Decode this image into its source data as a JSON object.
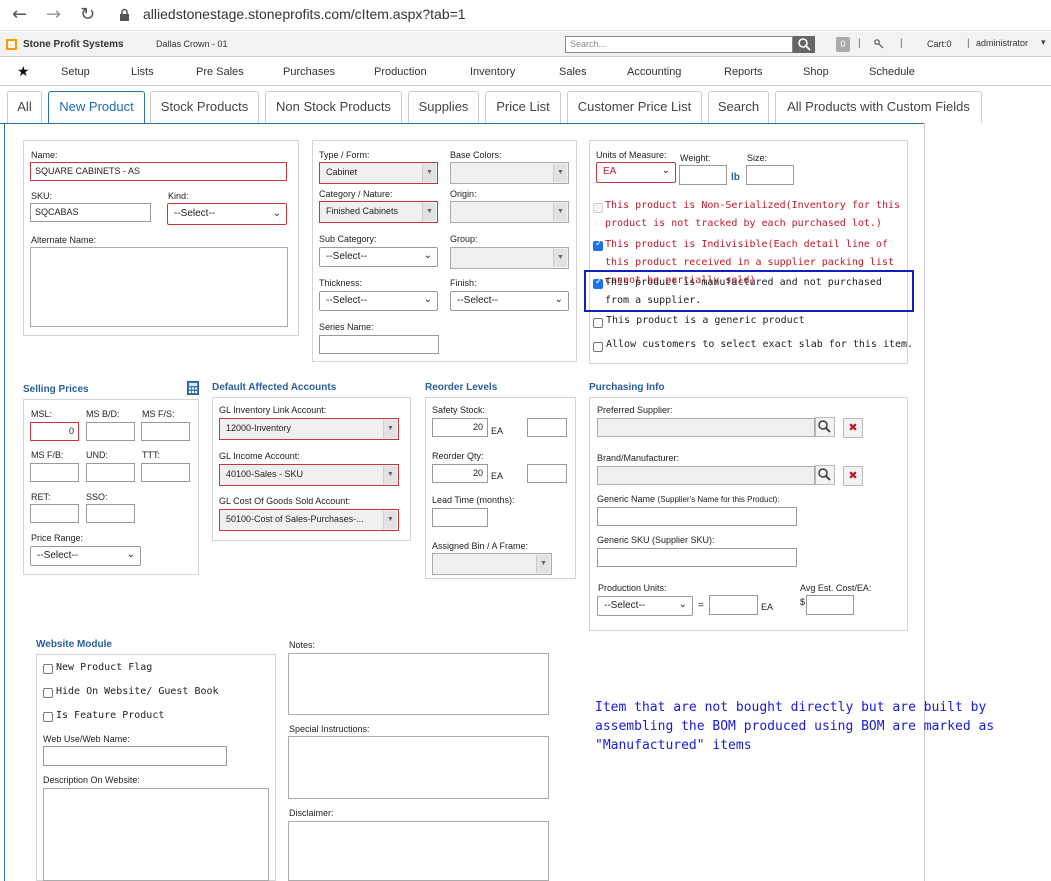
{
  "browser": {
    "back_icon": "arrow-left",
    "forward_icon": "arrow-right",
    "reload_icon": "reload",
    "lock_icon": "lock",
    "url": "alliedstonestage.stoneprofits.com/cItem.aspx?tab=1"
  },
  "header": {
    "brand": "Stone Profit Systems",
    "location": "Dallas Crown - 01",
    "search_placeholder": "Search...",
    "badge": "0",
    "cart": "Cart:0",
    "user": "administrator"
  },
  "nav": {
    "items": [
      "Setup",
      "Lists",
      "Pre Sales",
      "Purchases",
      "Production",
      "Inventory",
      "Sales",
      "Accounting",
      "Reports",
      "Shop",
      "Schedule"
    ]
  },
  "tabs": {
    "items": [
      "All",
      "New Product",
      "Stock Products",
      "Non Stock Products",
      "Supplies",
      "Price List",
      "Customer Price List",
      "Search",
      "All Products with Custom Fields"
    ],
    "active": "New Product"
  },
  "general": {
    "name_label": "Name:",
    "name_value": "SQUARE CABINETS - AS",
    "sku_label": "SKU:",
    "sku_value": "SQCABAS",
    "kind_label": "Kind:",
    "kind_value": "--Select--",
    "alt_name_label": "Alternate Name:"
  },
  "classification": {
    "type_label": "Type / Form:",
    "type_value": "Cabinet",
    "base_colors_label": "Base Colors:",
    "category_label": "Category / Nature:",
    "category_value": "Finished Cabinets",
    "origin_label": "Origin:",
    "subcategory_label": "Sub Category:",
    "subcategory_value": "--Select--",
    "group_label": "Group:",
    "thickness_label": "Thickness:",
    "thickness_value": "--Select--",
    "finish_label": "Finish:",
    "finish_value": "--Select--",
    "series_label": "Series Name:"
  },
  "units": {
    "uom_label": "Units of Measure:",
    "uom_value": "EA",
    "weight_label": "Weight:",
    "weight_unit": "lb",
    "size_label": "Size:",
    "opt_nonserialized": "This product is Non-Serialized(Inventory for this product is not tracked by each purchased lot.)",
    "opt_indivisible": "This product is Indivisible(Each detail line of this product received in a supplier packing list cannot be partially sold)",
    "opt_manufactured": "This product is manufactured and not purchased from a supplier.",
    "opt_generic": "This product is a generic product",
    "opt_exact_slab": "Allow customers to select exact slab for this item."
  },
  "selling": {
    "title": "Selling Prices",
    "msl_label": "MSL:",
    "msl_value": "0",
    "msbd_label": "MS B/D:",
    "msfs_label": "MS F/S:",
    "msfb_label": "MS F/B:",
    "und_label": "UND:",
    "ttt_label": "TTT:",
    "ret_label": "RET:",
    "sso_label": "SSO:",
    "price_range_label": "Price Range:",
    "price_range_value": "--Select--"
  },
  "accounts": {
    "title": "Default Affected Accounts",
    "inv_label": "GL Inventory Link Account:",
    "inv_value": "12000-Inventory",
    "income_label": "GL Income Account:",
    "income_value": "40100-Sales - SKU",
    "cogs_label": "GL Cost Of Goods Sold Account:",
    "cogs_value": "50100-Cost of Sales-Purchases-..."
  },
  "reorder": {
    "title": "Reorder Levels",
    "safety_label": "Safety Stock:",
    "safety_value": "20",
    "safety_unit": "EA",
    "reorder_label": "Reorder Qty:",
    "reorder_value": "20",
    "reorder_unit": "EA",
    "lead_label": "Lead Time (months):",
    "bin_label": "Assigned Bin / A Frame:"
  },
  "purchasing": {
    "title": "Purchasing Info",
    "pref_supplier_label": "Preferred Supplier:",
    "brand_label": "Brand/Manufacturer:",
    "generic_name_label": "Generic Name",
    "generic_name_hint": "(Supplier's Name for this Product):",
    "generic_sku_label": "Generic SKU (Supplier SKU):",
    "prod_units_label": "Production Units:",
    "prod_units_value": "--Select--",
    "equals": "=",
    "prod_units_unit": "EA",
    "avg_cost_label": "Avg Est. Cost/EA:",
    "currency": "$"
  },
  "website": {
    "title": "Website Module",
    "new_flag": "New Product Flag",
    "hide": "Hide On Website/ Guest Book",
    "feature": "Is Feature Product",
    "web_name_label": "Web Use/Web Name:",
    "desc_label": "Description On Website:"
  },
  "notes": {
    "notes_label": "Notes:",
    "special_label": "Special Instructions:",
    "disclaimer_label": "Disclaimer:"
  },
  "annotation": "Item that are not bought directly but are built by assembling the BOM produced using BOM are marked as \"Manufactured\" items"
}
